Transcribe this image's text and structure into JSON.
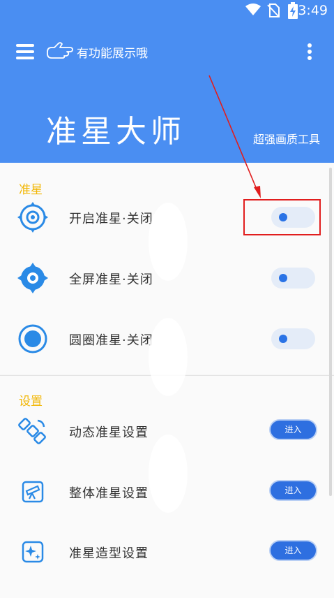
{
  "status": {
    "time": "3:49"
  },
  "header": {
    "subtitle": "有功能展示哦",
    "title": "准星大师",
    "tagline": "超强画质工具"
  },
  "sections": {
    "crosshair": {
      "title": "准星",
      "items": [
        {
          "label": "开启准星·关闭",
          "icon": "crosshair-target-icon"
        },
        {
          "label": "全屏准星·关闭",
          "icon": "crosshair-fullscreen-icon"
        },
        {
          "label": "圆圈准星·关闭",
          "icon": "crosshair-circle-icon"
        }
      ]
    },
    "settings": {
      "title": "设置",
      "items": [
        {
          "label": "动态准星设置",
          "button": "进入",
          "icon": "satellite-icon"
        },
        {
          "label": "整体准星设置",
          "button": "进入",
          "icon": "telescope-icon"
        },
        {
          "label": "准星造型设置",
          "button": "进入",
          "icon": "sparkle-icon"
        }
      ]
    }
  },
  "colors": {
    "header_bg": "#4a8ef2",
    "accent": "#2a73e6",
    "section_title": "#f2b705",
    "annotation": "#e11d1d"
  }
}
